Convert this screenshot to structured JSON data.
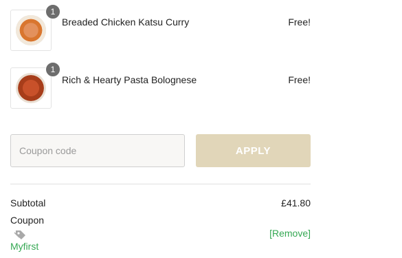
{
  "cart": {
    "items": [
      {
        "name": "Breaded Chicken Katsu Curry",
        "quantity": "1",
        "price": "Free!",
        "image": "katsu-curry-plate"
      },
      {
        "name": "Rich & Hearty Pasta Bolognese",
        "quantity": "1",
        "price": "Free!",
        "image": "pasta-bolognese-plate"
      }
    ]
  },
  "coupon": {
    "placeholder": "Coupon code",
    "value": "",
    "apply_label": "APPLY"
  },
  "totals": {
    "subtotal_label": "Subtotal",
    "subtotal_value": "£41.80",
    "coupon_label": "Coupon",
    "coupon_code": "Myfirst",
    "remove_label": "[Remove]",
    "coupon_icon": "tag-icon"
  },
  "colors": {
    "accent_green": "#35a853",
    "apply_button": "#e1d6b9",
    "badge": "#6d6d6d"
  }
}
